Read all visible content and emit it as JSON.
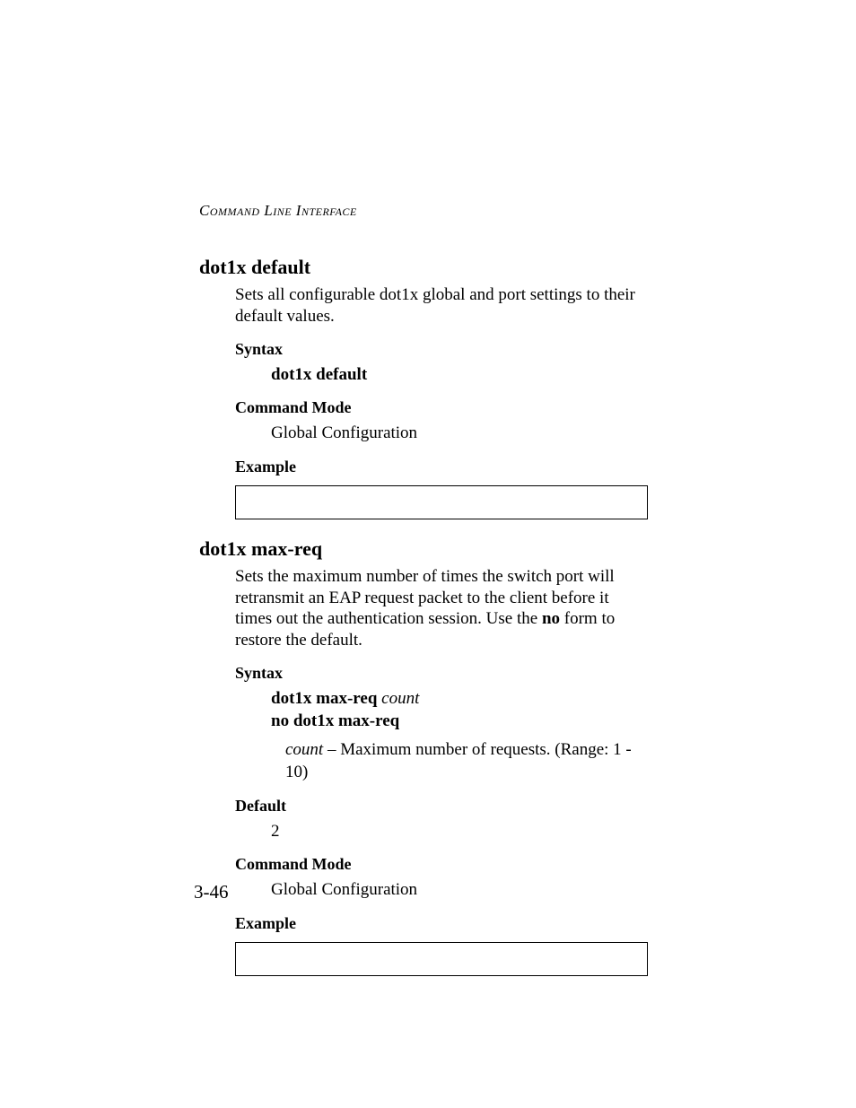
{
  "running_head": "Command Line Interface",
  "page_number": "3-46",
  "section1": {
    "title": "dot1x default",
    "description": "Sets all configurable dot1x global and port settings to their default values.",
    "syntax_label": "Syntax",
    "syntax_command": "dot1x default",
    "mode_label": "Command Mode",
    "mode_value": "Global Configuration",
    "example_label": "Example"
  },
  "section2": {
    "title": "dot1x max-req",
    "desc_pre": "Sets the maximum number of times the switch port will retransmit an EAP request packet to the client before it times out the authentication session. Use the ",
    "desc_bold": "no",
    "desc_post": " form to restore the default.",
    "syntax_label": "Syntax",
    "syntax_cmd_bold": "dot1x max-req",
    "syntax_cmd_ital": " count",
    "syntax_no_cmd": "no dot1x max-req",
    "param_ital": "count",
    "param_desc": " – Maximum number of requests. (Range: 1 - 10)",
    "default_label": "Default",
    "default_value": "2",
    "mode_label": "Command Mode",
    "mode_value": "Global Configuration",
    "example_label": "Example"
  }
}
